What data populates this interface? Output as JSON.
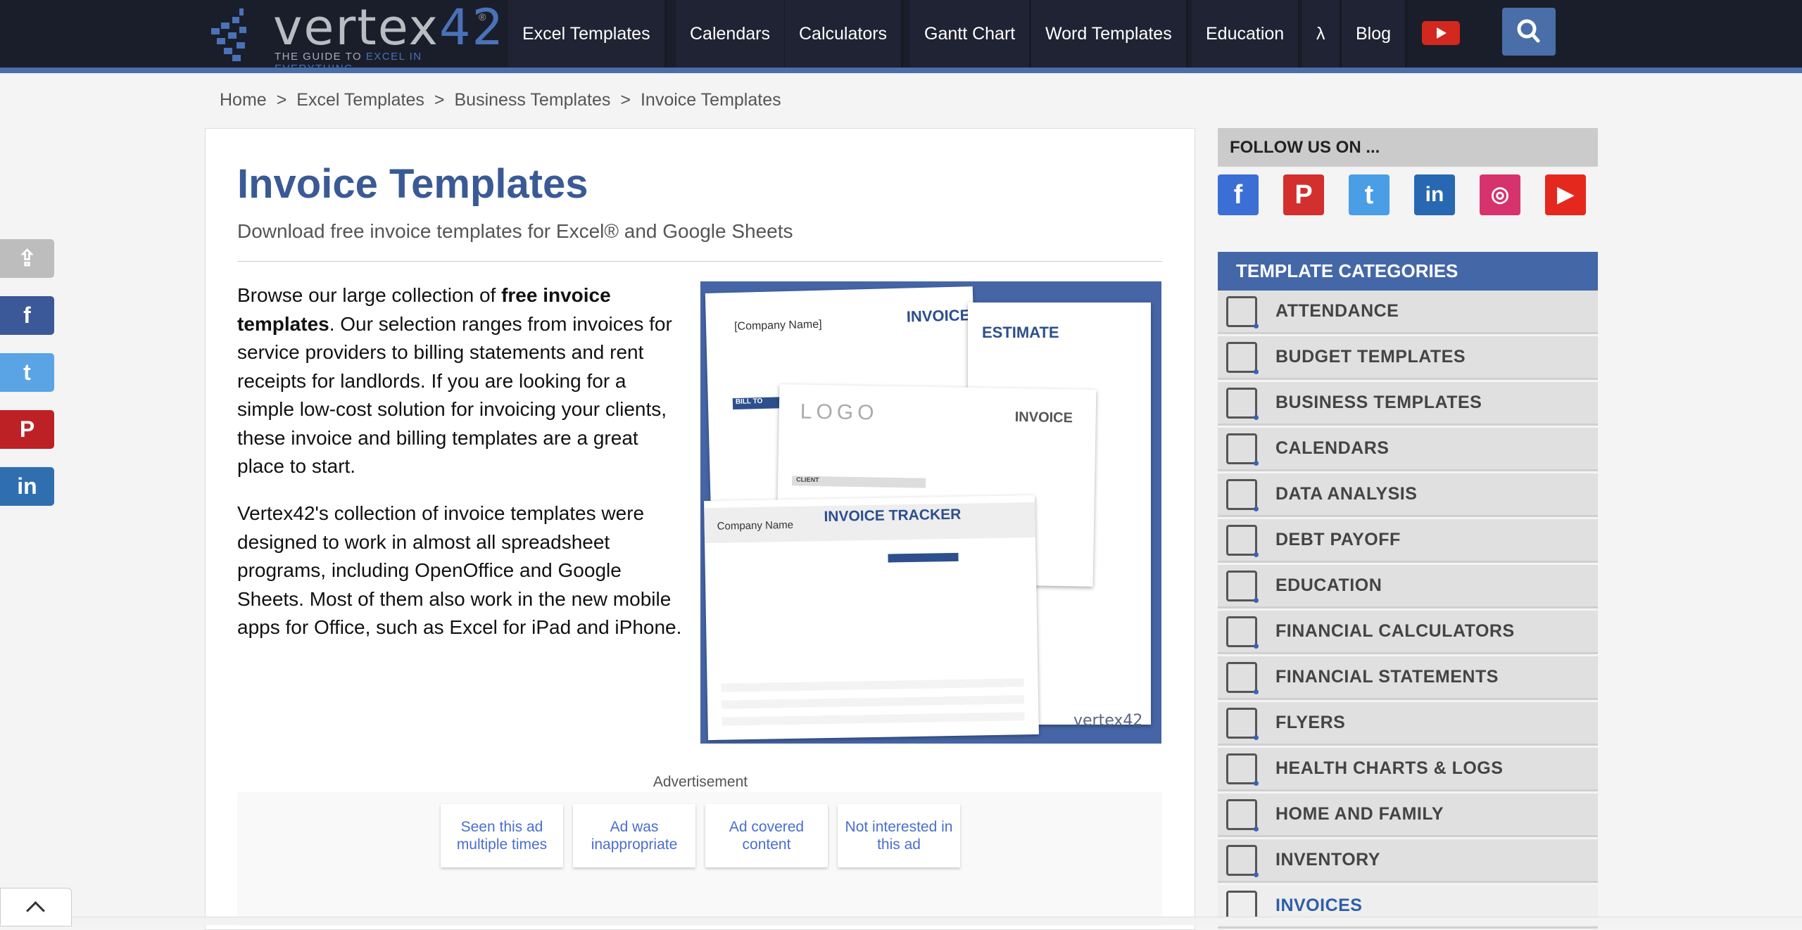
{
  "logo": {
    "word_a": "vertex",
    "word_b": "42",
    "reg": "®",
    "tag_a": "THE GUIDE TO ",
    "tag_b": "EXCEL IN EVERYTHING"
  },
  "nav": {
    "items": [
      "Excel Templates",
      "Calendars",
      "Calculators",
      "Gantt Chart",
      "Word Templates",
      "Education",
      "λ",
      "Blog"
    ],
    "youtube_icon": "youtube-icon",
    "search_icon": "search-icon"
  },
  "breadcrumb": [
    "Home",
    ">",
    "Excel Templates",
    ">",
    "Business Templates",
    ">",
    "Invoice Templates"
  ],
  "main": {
    "title": "Invoice Templates",
    "subtitle": "Download free invoice templates for Excel® and Google Sheets",
    "p1_a": "Browse our large collection of ",
    "p1_b": "free invoice templates",
    "p1_c": ". Our selection ranges from invoices for service providers to billing statements and rent receipts for landlords. If you are looking for a simple low-cost solution for invoicing your clients, these invoice and billing templates are a great place to start.",
    "p2": "Vertex42's collection of invoice templates were designed to work in almost all spreadsheet programs, including OpenOffice and Google Sheets. Most of them also work in the new mobile apps for Office, such as Excel for iPad and iPhone.",
    "image": {
      "invoice1": "INVOICE",
      "company": "[Company Name]",
      "estimate": "ESTIMATE",
      "logo": "LOGO",
      "invoice2": "INVOICE",
      "tracker": "INVOICE TRACKER",
      "tracker_company": "Company Name",
      "bill_to": "BILL TO",
      "client": "CLIENT",
      "watermark": "vertex42"
    }
  },
  "ad": {
    "label": "Advertisement",
    "buttons": [
      "Seen this ad multiple times",
      "Ad was inappropriate",
      "Ad covered content",
      "Not interested in this ad"
    ]
  },
  "sidebar": {
    "follow": "FOLLOW US ON ...",
    "social": [
      {
        "name": "facebook",
        "glyph": "f",
        "color": "#3b6fd6"
      },
      {
        "name": "pinterest",
        "glyph": "P",
        "color": "#d32f2f"
      },
      {
        "name": "twitter",
        "glyph": "t",
        "color": "#4a9ee6"
      },
      {
        "name": "linkedin",
        "glyph": "in",
        "color": "#2867b2"
      },
      {
        "name": "instagram",
        "glyph": "◎",
        "color": "#d6336c"
      },
      {
        "name": "youtube",
        "glyph": "▶",
        "color": "#e5281e"
      }
    ],
    "categories_title": "TEMPLATE CATEGORIES",
    "categories": [
      "ATTENDANCE",
      "BUDGET TEMPLATES",
      "BUSINESS TEMPLATES",
      "CALENDARS",
      "DATA ANALYSIS",
      "DEBT PAYOFF",
      "EDUCATION",
      "FINANCIAL CALCULATORS",
      "FINANCIAL STATEMENTS",
      "FLYERS",
      "HEALTH CHARTS & LOGS",
      "HOME AND FAMILY",
      "INVENTORY",
      "INVOICES"
    ],
    "active": "INVOICES"
  },
  "share": [
    {
      "name": "share",
      "glyph": "⇪",
      "color": "#bdbdbd"
    },
    {
      "name": "facebook",
      "glyph": "f",
      "color": "#3b5998"
    },
    {
      "name": "twitter",
      "glyph": "t",
      "color": "#5aa4e6"
    },
    {
      "name": "pinterest",
      "glyph": "P",
      "color": "#bd2126"
    },
    {
      "name": "linkedin",
      "glyph": "in",
      "color": "#2f6fb0"
    }
  ],
  "colors": {
    "accent": "#4a6ea8",
    "nav_bg": "#1a1e2a",
    "title": "#3a5a96"
  }
}
